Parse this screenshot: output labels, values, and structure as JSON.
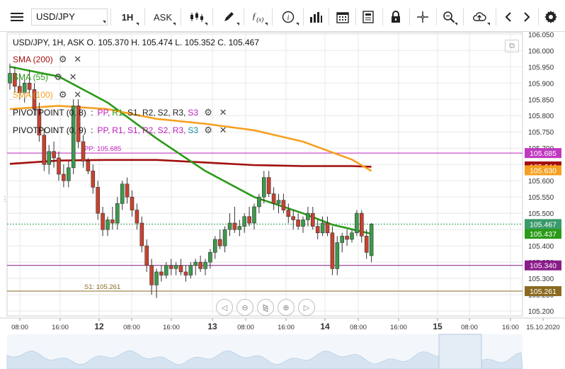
{
  "toolbar": {
    "symbol": "USD/JPY",
    "timeframe": "1H",
    "price_type": "ASK"
  },
  "legend": {
    "ohlc": "USD/JPY, 1H, ASK   O. 105.370 H. 105.474 L. 105.352 C. 105.467",
    "indicators": [
      {
        "label": "SMA (200)",
        "color": "#a30f0f"
      },
      {
        "label": "SMA (55)",
        "color": "#2a9a18"
      },
      {
        "label": "SMA (100)",
        "color": "#f5a020"
      }
    ],
    "pivots": [
      {
        "label": "PIVOTPOINT (0, 8)",
        "parts": [
          {
            "t": "PP",
            "c": "#bf20bf"
          },
          {
            "t": "R1",
            "c": "#2a9a18"
          },
          {
            "t": "S1",
            "c": "#222222"
          },
          {
            "t": "R2",
            "c": "#222222"
          },
          {
            "t": "S2",
            "c": "#222222"
          },
          {
            "t": "R3",
            "c": "#222222"
          },
          {
            "t": "S3",
            "c": "#bf20bf"
          }
        ]
      },
      {
        "label": "PIVOTPOINT (0, 9)",
        "parts": [
          {
            "t": "PP",
            "c": "#bf20bf"
          },
          {
            "t": "R1",
            "c": "#bf20bf"
          },
          {
            "t": "S1",
            "c": "#bf20bf"
          },
          {
            "t": "R2",
            "c": "#bf20bf"
          },
          {
            "t": "S2",
            "c": "#bf20bf"
          },
          {
            "t": "R3",
            "c": "#bf20bf"
          },
          {
            "t": "S3",
            "c": "#1a8f9a"
          }
        ]
      }
    ]
  },
  "chart_data": {
    "type": "candlestick",
    "symbol": "USD/JPY",
    "timeframe": "1H",
    "y_ticks": [
      "106.050",
      "106.000",
      "105.950",
      "105.900",
      "105.850",
      "105.800",
      "105.750",
      "105.700",
      "105.650",
      "105.600",
      "105.550",
      "105.500",
      "105.450",
      "105.400",
      "105.350",
      "105.300",
      "105.250",
      "105.200"
    ],
    "ylim": [
      105.185,
      106.055
    ],
    "x_ticks": [
      "08:00",
      "16:00",
      "12",
      "08:00",
      "16:00",
      "13",
      "08:00",
      "16:00",
      "14",
      "08:00",
      "16:00",
      "15",
      "08:00",
      "16:00",
      "15.10.2020"
    ],
    "x_tick_bold": [
      false,
      false,
      true,
      false,
      false,
      true,
      false,
      false,
      true,
      false,
      false,
      true,
      false,
      false,
      false
    ],
    "candles": [
      [
        105.9,
        105.96,
        105.88,
        105.93
      ],
      [
        105.93,
        105.95,
        105.87,
        105.89
      ],
      [
        105.89,
        105.93,
        105.85,
        105.87
      ],
      [
        105.87,
        105.91,
        105.84,
        105.9
      ],
      [
        105.9,
        105.94,
        105.86,
        105.88
      ],
      [
        105.88,
        105.9,
        105.8,
        105.82
      ],
      [
        105.82,
        105.84,
        105.72,
        105.74
      ],
      [
        105.74,
        105.76,
        105.63,
        105.65
      ],
      [
        105.65,
        105.71,
        105.62,
        105.69
      ],
      [
        105.69,
        105.72,
        105.64,
        105.67
      ],
      [
        105.67,
        105.69,
        105.6,
        105.62
      ],
      [
        105.62,
        105.65,
        105.58,
        105.6
      ],
      [
        105.6,
        105.66,
        105.58,
        105.64
      ],
      [
        105.64,
        105.85,
        105.62,
        105.83
      ],
      [
        105.83,
        105.85,
        105.7,
        105.72
      ],
      [
        105.72,
        105.74,
        105.64,
        105.66
      ],
      [
        105.66,
        105.67,
        105.62,
        105.63
      ],
      [
        105.63,
        105.65,
        105.56,
        105.58
      ],
      [
        105.58,
        105.6,
        105.48,
        105.5
      ],
      [
        105.5,
        105.52,
        105.43,
        105.45
      ],
      [
        105.45,
        105.49,
        105.43,
        105.48
      ],
      [
        105.48,
        105.52,
        105.45,
        105.47
      ],
      [
        105.47,
        105.55,
        105.45,
        105.53
      ],
      [
        105.53,
        105.6,
        105.51,
        105.59
      ],
      [
        105.59,
        105.61,
        105.53,
        105.55
      ],
      [
        105.55,
        105.57,
        105.49,
        105.51
      ],
      [
        105.51,
        105.53,
        105.45,
        105.47
      ],
      [
        105.47,
        105.49,
        105.38,
        105.4
      ],
      [
        105.4,
        105.42,
        105.32,
        105.34
      ],
      [
        105.34,
        105.36,
        105.25,
        105.28
      ],
      [
        105.28,
        105.33,
        105.24,
        105.32
      ],
      [
        105.32,
        105.34,
        105.29,
        105.31
      ],
      [
        105.31,
        105.35,
        105.3,
        105.34
      ],
      [
        105.34,
        105.36,
        105.31,
        105.33
      ],
      [
        105.33,
        105.35,
        105.31,
        105.34
      ],
      [
        105.34,
        105.36,
        105.31,
        105.32
      ],
      [
        105.32,
        105.34,
        105.29,
        105.31
      ],
      [
        105.31,
        105.35,
        105.3,
        105.34
      ],
      [
        105.34,
        105.36,
        105.31,
        105.35
      ],
      [
        105.35,
        105.37,
        105.32,
        105.33
      ],
      [
        105.33,
        105.36,
        105.31,
        105.35
      ],
      [
        105.35,
        105.39,
        105.33,
        105.38
      ],
      [
        105.38,
        105.43,
        105.36,
        105.42
      ],
      [
        105.42,
        105.45,
        105.39,
        105.4
      ],
      [
        105.4,
        105.46,
        105.38,
        105.45
      ],
      [
        105.45,
        105.5,
        105.43,
        105.47
      ],
      [
        105.47,
        105.52,
        105.44,
        105.45
      ],
      [
        105.45,
        105.48,
        105.43,
        105.46
      ],
      [
        105.46,
        105.5,
        105.44,
        105.49
      ],
      [
        105.49,
        105.52,
        105.46,
        105.47
      ],
      [
        105.47,
        105.53,
        105.45,
        105.52
      ],
      [
        105.52,
        105.56,
        105.5,
        105.55
      ],
      [
        105.55,
        105.63,
        105.53,
        105.61
      ],
      [
        105.61,
        105.63,
        105.55,
        105.56
      ],
      [
        105.56,
        105.58,
        105.51,
        105.53
      ],
      [
        105.53,
        105.56,
        105.5,
        105.54
      ],
      [
        105.54,
        105.56,
        105.5,
        105.51
      ],
      [
        105.51,
        105.53,
        105.47,
        105.49
      ],
      [
        105.49,
        105.51,
        105.45,
        105.48
      ],
      [
        105.48,
        105.5,
        105.45,
        105.46
      ],
      [
        105.46,
        105.49,
        105.44,
        105.48
      ],
      [
        105.48,
        105.52,
        105.46,
        105.5
      ],
      [
        105.5,
        105.52,
        105.45,
        105.46
      ],
      [
        105.46,
        105.48,
        105.42,
        105.44
      ],
      [
        105.44,
        105.49,
        105.43,
        105.47
      ],
      [
        105.47,
        105.49,
        105.43,
        105.44
      ],
      [
        105.44,
        105.46,
        105.31,
        105.33
      ],
      [
        105.33,
        105.43,
        105.31,
        105.41
      ],
      [
        105.41,
        105.44,
        105.38,
        105.43
      ],
      [
        105.43,
        105.45,
        105.4,
        105.42
      ],
      [
        105.42,
        105.45,
        105.41,
        105.44
      ],
      [
        105.44,
        105.51,
        105.43,
        105.5
      ],
      [
        105.5,
        105.51,
        105.41,
        105.43
      ],
      [
        105.43,
        105.45,
        105.36,
        105.38
      ],
      [
        105.37,
        105.47,
        105.35,
        105.467
      ]
    ],
    "series": [
      {
        "name": "SMA (200)",
        "color": "#a30f0f",
        "points": [
          [
            0,
            105.652
          ],
          [
            10,
            105.662
          ],
          [
            20,
            105.664
          ],
          [
            30,
            105.664
          ],
          [
            40,
            105.656
          ],
          [
            50,
            105.648
          ],
          [
            60,
            105.645
          ],
          [
            70,
            105.645
          ],
          [
            74,
            105.643
          ]
        ]
      },
      {
        "name": "SMA (55)",
        "color": "#2a9a18",
        "points": [
          [
            0,
            105.95
          ],
          [
            10,
            105.92
          ],
          [
            20,
            105.84
          ],
          [
            30,
            105.73
          ],
          [
            40,
            105.63
          ],
          [
            50,
            105.55
          ],
          [
            60,
            105.5
          ],
          [
            66,
            105.465
          ],
          [
            74,
            105.437
          ]
        ]
      },
      {
        "name": "SMA (100)",
        "color": "#f5a020",
        "points": [
          [
            0,
            105.82
          ],
          [
            10,
            105.83
          ],
          [
            20,
            105.82
          ],
          [
            30,
            105.79
          ],
          [
            40,
            105.775
          ],
          [
            50,
            105.755
          ],
          [
            60,
            105.72
          ],
          [
            70,
            105.665
          ],
          [
            74,
            105.63
          ]
        ]
      }
    ],
    "levels": [
      {
        "label": "PP: 105.685",
        "value": 105.685,
        "color": "#bf20bf",
        "dashed": false,
        "price": "105.685"
      },
      {
        "label": "",
        "value": 105.34,
        "color": "#8a1c8a",
        "dashed": false,
        "price": "105.340"
      },
      {
        "label": "S1: 105.261",
        "value": 105.261,
        "color": "#8a6a20",
        "dashed": false,
        "price": "105.261"
      },
      {
        "label": "",
        "value": 105.467,
        "color": "#2a9a4a",
        "dashed": true,
        "price": "105.467"
      }
    ],
    "price_tags": [
      {
        "value": 105.685,
        "text": "105.685",
        "bg": "#c03ac0",
        "fg": "#ffffff"
      },
      {
        "value": 105.644,
        "text": "105.644",
        "bg": "#a30f0f",
        "fg": "#ffffff"
      },
      {
        "value": 105.632,
        "text": "105.630",
        "bg": "#f5a020",
        "fg": "#ffffff"
      },
      {
        "value": 105.467,
        "text": "105.467",
        "bg": "#3a9a6a",
        "fg": "#ffffff"
      },
      {
        "value": 105.437,
        "text": "105.437",
        "bg": "#2a9a18",
        "fg": "#ffffff"
      },
      {
        "value": 105.34,
        "text": "105.340",
        "bg": "#8a1c8a",
        "fg": "#ffffff"
      },
      {
        "value": 105.261,
        "text": "105.261",
        "bg": "#8a6a20",
        "fg": "#ffffff"
      }
    ],
    "colors": {
      "up": "#3c9a4c",
      "down": "#c9422f",
      "grid": "#e8e8e8"
    }
  }
}
